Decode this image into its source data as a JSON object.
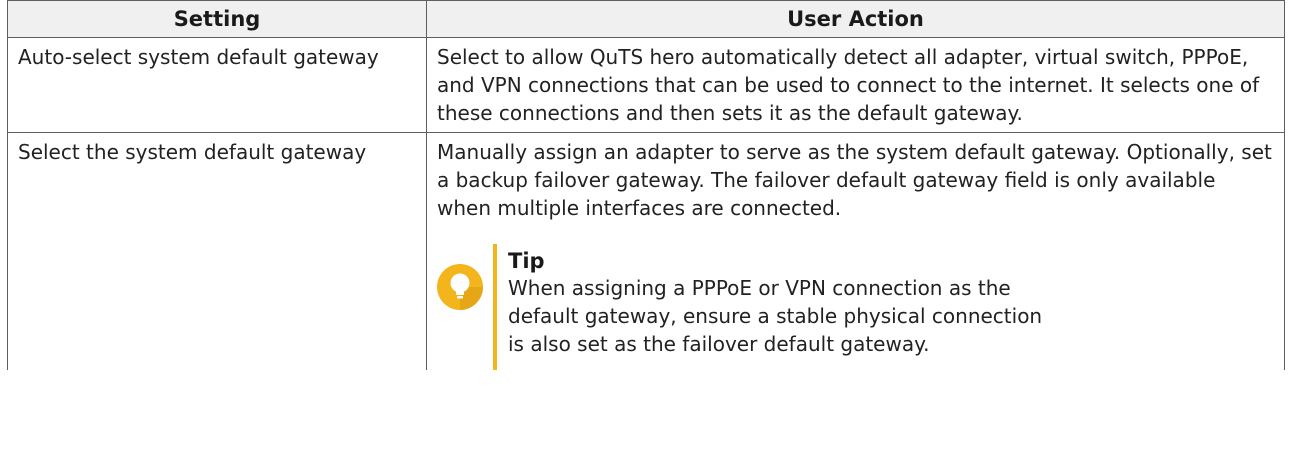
{
  "table": {
    "headers": [
      "Setting",
      "User Action"
    ],
    "rows": [
      {
        "setting": "Auto-select system default gateway",
        "action": "Select to allow QuTS hero automatically detect all adapter, virtual switch, PPPoE, and VPN connections that can be used to connect to the internet. It selects one of these connections and then sets it as the default gateway."
      },
      {
        "setting": "Select the system default gateway",
        "action": "Manually assign an adapter to serve as the system default gateway. Optionally, set a backup failover gateway. The failover default gateway field is only available when multiple interfaces are connected.",
        "tip": {
          "icon": "lightbulb-icon",
          "title": "Tip",
          "body": "When assigning a PPPoE or VPN connection as the default gateway, ensure a stable physical connection is also set as the failover default gateway."
        }
      }
    ]
  },
  "colors": {
    "tip_accent": "#f3b51b",
    "header_bg": "#f0f0f0",
    "border": "#5f5f5f"
  }
}
